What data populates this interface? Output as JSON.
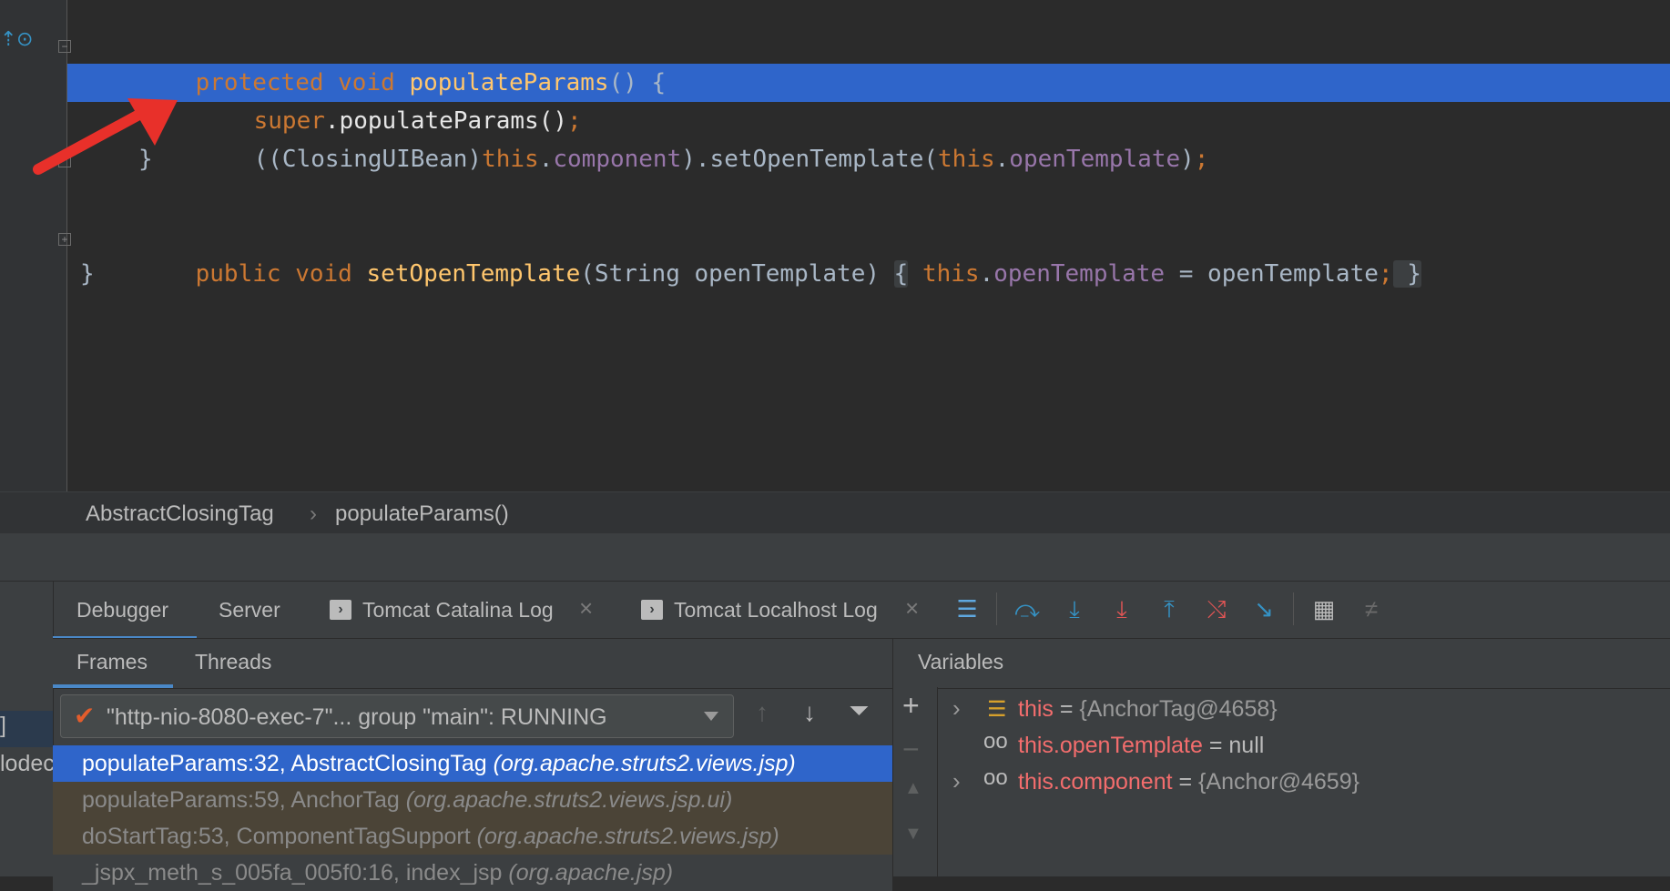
{
  "editor": {
    "lines": [
      {
        "line": "line-1"
      },
      {
        "line": "line-2"
      }
    ],
    "code": {
      "l1_kw": "protected void ",
      "l1_fn": "populateParams",
      "l1_rest": "() {",
      "l2_super": "super",
      "l2_rest": ".populateParams()",
      "l2_semi": ";",
      "l3_a": "((ClosingUIBean)",
      "l3_this": "this",
      "l3_dot": ".",
      "l3_field": "component",
      "l3_b": ").setOpenTemplate(",
      "l3_this2": "this",
      "l3_dot2": ".",
      "l3_field2": "openTemplate",
      "l3_c": ")",
      "l3_semi": ";",
      "l4": "}",
      "l6_kw": "public void ",
      "l6_fn": "setOpenTemplate",
      "l6_sig": "(String openTemplate) ",
      "l6_ob": "{",
      "l6_this": " this",
      "l6_dot": ".",
      "l6_field": "openTemplate",
      "l6_assign": " = openTemplate",
      "l6_semi": ";",
      "l6_cb": " }",
      "l7": "}"
    }
  },
  "breadcrumb": {
    "class_name": "AbstractClosingTag",
    "separator": "›",
    "method_name": "populateParams()"
  },
  "toolwindow": {
    "tabs": {
      "debugger": "Debugger",
      "server": "Server",
      "catalina": "Tomcat Catalina Log",
      "localhost": "Tomcat Localhost Log"
    },
    "subtabs": {
      "frames": "Frames",
      "threads": "Threads",
      "variables": "Variables"
    },
    "thread": "\"http-nio-8080-exec-7\"... group \"main\": RUNNING",
    "frames": [
      {
        "method": "populateParams:32, AbstractClosingTag ",
        "pkg": "(org.apache.struts2.views.jsp)"
      },
      {
        "method": "populateParams:59, AnchorTag ",
        "pkg": "(org.apache.struts2.views.jsp.ui)"
      },
      {
        "method": "doStartTag:53, ComponentTagSupport ",
        "pkg": "(org.apache.struts2.views.jsp)"
      },
      {
        "method": "_jspx_meth_s_005fa_005f0:16, index_jsp ",
        "pkg": "(org.apache.jsp)"
      }
    ],
    "variables": [
      {
        "name": "this",
        "eq": " = ",
        "value": "{AnchorTag@4658}"
      },
      {
        "name": "this.openTemplate",
        "eq": " = ",
        "value": "null"
      },
      {
        "name": "this.component",
        "eq": " = ",
        "value": "{Anchor@4659}"
      }
    ],
    "left_partial": {
      "bracket": "]",
      "text": "lodec"
    }
  },
  "colors": {
    "editor_bg": "#2b2b2b",
    "selection": "#2f65ca",
    "keyword": "#cc7832",
    "function": "#ffc66d",
    "field": "#9876aa",
    "arrow": "#e8302a"
  }
}
